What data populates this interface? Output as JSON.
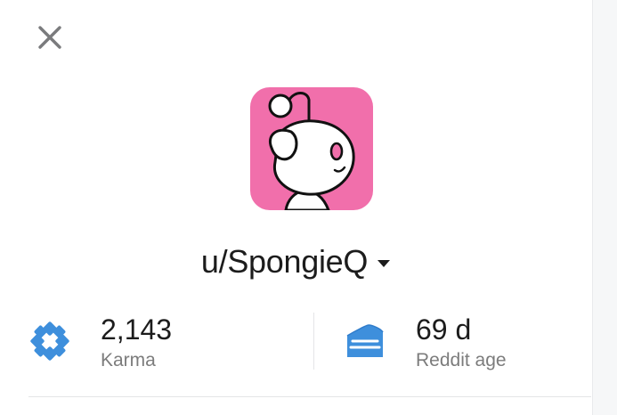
{
  "profile": {
    "username": "u/SpongieQ",
    "avatar_color": "#f16fab"
  },
  "stats": {
    "karma": {
      "value": "2,143",
      "label": "Karma",
      "icon": "karma-icon",
      "color": "#3e8fdc"
    },
    "age": {
      "value": "69 d",
      "label": "Reddit age",
      "icon": "cake-icon",
      "color": "#3e8fdc"
    }
  },
  "icons": {
    "close": "close-icon",
    "dropdown": "chevron-down-icon"
  }
}
